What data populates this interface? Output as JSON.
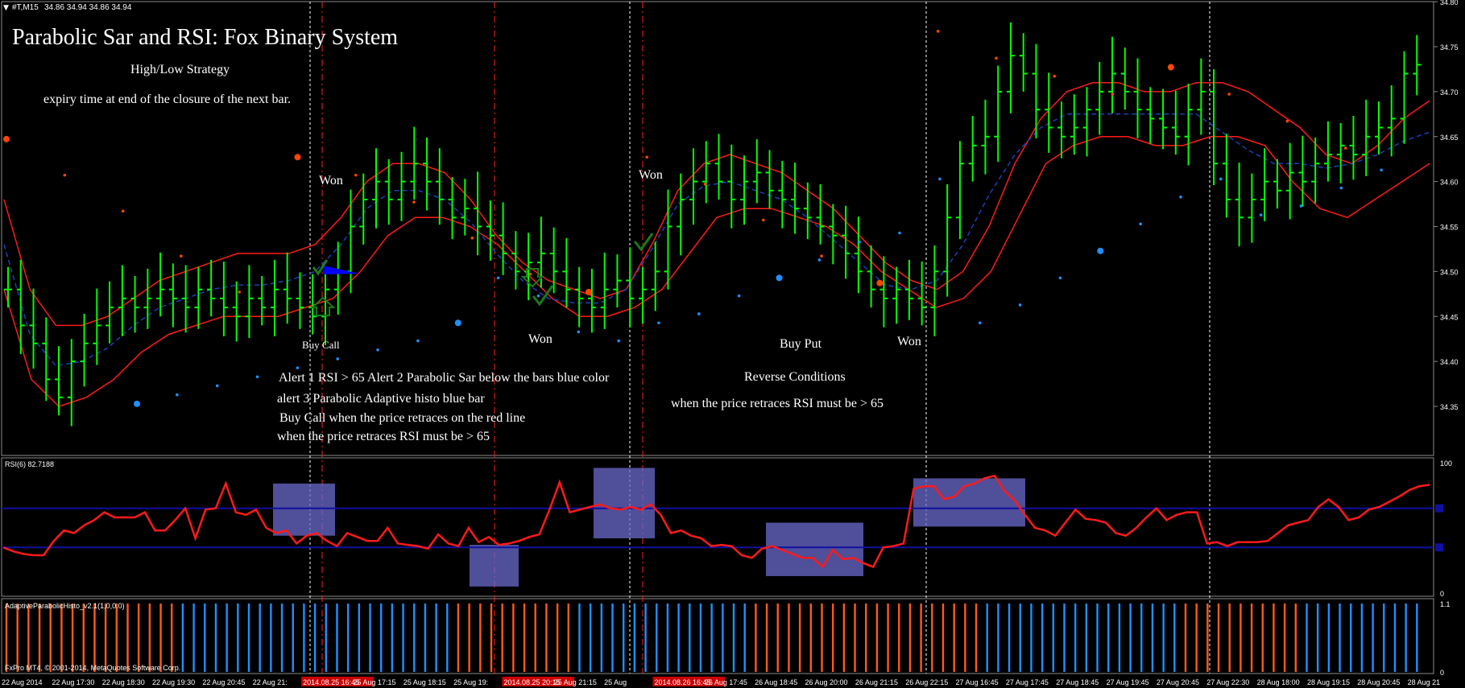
{
  "window": {
    "symbol_header": "#T,M15",
    "ohlc_header": "34.86 34.94 34.86 34.94",
    "copyright": "FxPro MT4, © 2001-2014, MetaQuotes Software Corp."
  },
  "annotations": {
    "title": "Parabolic Sar and RSI: Fox Binary System",
    "subtitle": "High/Low Strategy",
    "expiry": "expiry time at end of the closure of the next bar.",
    "won_1": "Won",
    "won_2": "Won",
    "won_3": "Won",
    "won_4": "Won",
    "buy_call": "Buy Call",
    "buy_put": "Buy Put",
    "alert_line_1": "Alert 1 RSI > 65     Alert 2 Parabolic Sar below the bars blue color",
    "alert_line_2": "alert 3 Parabolic Adaptive histo blue bar",
    "alert_line_3": "Buy Call when the price retraces on the red line",
    "alert_line_4": "when the price retraces RSI must be > 65",
    "reverse_title": "Reverse Conditions",
    "reverse_line": "when the price retraces RSI must be > 65"
  },
  "colors": {
    "background": "#000000",
    "grid": "#7a7a7a",
    "bar_bull": "#00ff00",
    "envelope": "#ff1a1a",
    "midline": "#1c3fb8",
    "sar_up": "#1e90ff",
    "sar_down": "#ff4500",
    "rsi_line": "#ff1a1a",
    "rsi_levels": "#1010a0",
    "box_fill": "#6a6acd",
    "histo_blue": "#1e90ff",
    "histo_orange": "#ff5a1a",
    "event_line": "#ff2020",
    "highlight": "#cc0000"
  },
  "chart_data": [
    {
      "type": "ohlc",
      "title": "#T,M15",
      "ylim": [
        34.3,
        34.8
      ],
      "y_ticks": [
        "34.80",
        "34.75",
        "34.70",
        "34.65",
        "34.60",
        "34.55",
        "34.50",
        "34.45",
        "34.40",
        "34.35"
      ],
      "series": [
        {
          "name": "close",
          "values": [
            34.48,
            34.44,
            34.42,
            34.38,
            34.36,
            34.4,
            34.42,
            34.44,
            34.46,
            34.47,
            34.46,
            34.47,
            34.48,
            34.47,
            34.46,
            34.48,
            34.47,
            34.46,
            34.45,
            34.47,
            34.46,
            34.48,
            34.47,
            34.46,
            34.45,
            34.48,
            34.5,
            34.55,
            34.58,
            34.6,
            34.58,
            34.6,
            34.62,
            34.6,
            34.58,
            34.56,
            34.57,
            34.55,
            34.54,
            34.52,
            34.5,
            34.51,
            34.52,
            34.5,
            34.48,
            34.47,
            34.46,
            34.48,
            34.49,
            34.47,
            34.48,
            34.5,
            34.55,
            34.58,
            34.6,
            34.62,
            34.6,
            34.58,
            34.6,
            34.61,
            34.59,
            34.58,
            34.57,
            34.56,
            34.55,
            34.54,
            34.52,
            34.5,
            34.48,
            34.47,
            34.48,
            34.47,
            34.46,
            34.5,
            34.56,
            34.62,
            34.64,
            34.65,
            34.7,
            34.74,
            34.72,
            34.68,
            34.66,
            34.65,
            34.66,
            34.68,
            34.7,
            34.72,
            34.7,
            34.68,
            34.67,
            34.66,
            34.65,
            34.68,
            34.7,
            34.62,
            34.58,
            34.56,
            34.58,
            34.6,
            34.59,
            34.61,
            34.6,
            34.62,
            34.63,
            34.64,
            34.63,
            34.65,
            34.66,
            34.67,
            34.72,
            34.73
          ]
        },
        {
          "name": "upper_band",
          "values": [
            34.58,
            34.48,
            34.44,
            34.44,
            34.45,
            34.47,
            34.49,
            34.5,
            34.51,
            34.52,
            34.52,
            34.52,
            34.53,
            34.56,
            34.6,
            34.62,
            34.62,
            34.61,
            34.58,
            34.54,
            34.51,
            34.49,
            34.48,
            34.47,
            34.48,
            34.53,
            34.59,
            34.62,
            34.63,
            34.62,
            34.61,
            34.59,
            34.57,
            34.54,
            34.51,
            34.49,
            34.48,
            34.5,
            34.55,
            34.62,
            34.67,
            34.7,
            34.71,
            34.71,
            34.7,
            34.7,
            34.71,
            34.71,
            34.7,
            34.68,
            34.66,
            34.63,
            34.62,
            34.64,
            34.67,
            34.69
          ]
        },
        {
          "name": "lower_band",
          "values": [
            34.48,
            34.38,
            34.35,
            34.36,
            34.38,
            34.41,
            34.43,
            34.44,
            34.45,
            34.45,
            34.45,
            34.46,
            34.47,
            34.5,
            34.54,
            34.56,
            34.56,
            34.55,
            34.53,
            34.5,
            34.47,
            34.45,
            34.45,
            34.46,
            34.48,
            34.52,
            34.56,
            34.57,
            34.57,
            34.56,
            34.55,
            34.53,
            34.5,
            34.48,
            34.46,
            34.47,
            34.5,
            34.56,
            34.62,
            34.64,
            34.65,
            34.65,
            34.64,
            34.64,
            34.65,
            34.65,
            34.64,
            34.6,
            34.57,
            34.56,
            34.58,
            34.6,
            34.62
          ]
        }
      ],
      "sar_up_points": [
        34.36,
        34.37,
        34.38,
        34.39,
        34.4,
        34.41,
        34.42,
        34.43,
        34.45,
        34.5,
        34.48,
        34.44,
        34.43,
        34.45,
        34.46,
        34.48,
        34.5,
        34.52,
        34.54,
        34.55,
        34.61,
        34.45,
        34.47,
        34.5,
        34.53,
        34.56,
        34.59,
        34.61,
        34.57,
        34.58,
        34.6,
        34.62
      ],
      "sar_down_points": [
        34.64,
        34.6,
        34.56,
        34.51,
        34.47,
        34.62,
        34.6,
        34.57,
        34.53,
        34.49,
        34.47,
        34.62,
        34.59,
        34.55,
        34.51,
        34.48,
        34.76,
        34.73,
        34.71,
        34.69,
        34.72,
        34.69,
        34.66,
        34.63
      ]
    },
    {
      "type": "line",
      "title": "RSI(6) 82.7188",
      "ylim": [
        0,
        100
      ],
      "y_ticks": [
        "100",
        "0"
      ],
      "levels": [
        65,
        35
      ],
      "series": [
        {
          "name": "RSI(6)",
          "values": [
            35,
            32,
            30,
            29,
            29,
            40,
            48,
            46,
            52,
            56,
            62,
            58,
            58,
            58,
            62,
            48,
            48,
            56,
            65,
            42,
            64,
            65,
            84,
            62,
            60,
            64,
            50,
            46,
            48,
            38,
            44,
            46,
            40,
            36,
            46,
            43,
            40,
            40,
            50,
            38,
            37,
            36,
            34,
            45,
            38,
            36,
            50,
            39,
            43,
            37,
            38,
            40,
            43,
            45,
            64,
            85,
            62,
            64,
            66,
            68,
            65,
            64,
            66,
            64,
            68,
            60,
            46,
            48,
            44,
            42,
            36,
            37,
            36,
            29,
            27,
            34,
            36,
            33,
            30,
            27,
            27,
            20,
            33,
            26,
            27,
            23,
            20,
            35,
            36,
            38,
            80,
            82,
            82,
            72,
            74,
            82,
            84,
            88,
            90,
            78,
            71,
            60,
            50,
            48,
            44,
            54,
            64,
            57,
            56,
            54,
            46,
            44,
            50,
            58,
            65,
            56,
            60,
            62,
            62,
            38,
            39,
            36,
            39,
            39,
            39,
            40,
            46,
            52,
            54,
            56,
            66,
            72,
            66,
            56,
            58,
            64,
            66,
            70,
            74,
            79,
            82,
            83
          ]
        }
      ],
      "boxes": [
        "RSI > 65",
        "RSI < 35",
        "RSI > 65",
        "RSI < 35",
        "RSI > 65"
      ]
    },
    {
      "type": "bar",
      "title": "AdaptiveParabolicHisto_v2.1(1,0,0.0)",
      "ylim": [
        0,
        1.1
      ],
      "y_ticks": [
        "1.1",
        "0"
      ],
      "series": [
        {
          "name": "down (orange)",
          "values": [
            1,
            1,
            1,
            1,
            1,
            1,
            1,
            1,
            1,
            1,
            1,
            1,
            1,
            1,
            1,
            1,
            0,
            0,
            0,
            0,
            0,
            0,
            0,
            0,
            0,
            0,
            0,
            0,
            0,
            0,
            0,
            0,
            0,
            0,
            0,
            0,
            0,
            0,
            0,
            0,
            0,
            1,
            1,
            1,
            1,
            1,
            1,
            1,
            1,
            1,
            1,
            1,
            0,
            0,
            0,
            0,
            0,
            0,
            0,
            0,
            0,
            0,
            0,
            0,
            0,
            0,
            0,
            0,
            1,
            1,
            1,
            1,
            1,
            1,
            1,
            1,
            1,
            1,
            1,
            1,
            1,
            1,
            1,
            1,
            1,
            1,
            1,
            1,
            1,
            0,
            0,
            0,
            0,
            0,
            0,
            0,
            0,
            0,
            0,
            0,
            0,
            0,
            0,
            0,
            0,
            0,
            0,
            1,
            1,
            1,
            1,
            1,
            1,
            1,
            1,
            1,
            1,
            1,
            0,
            0,
            0,
            0,
            0,
            0,
            0,
            0,
            0,
            0,
            0
          ]
        }
      ]
    }
  ],
  "x_axis": {
    "labels": [
      "22 Aug 2014",
      "22 Aug 17:30",
      "22 Aug 18:30",
      "22 Aug 19:30",
      "22 Aug 20:45",
      "22 Aug 21:",
      "2014.08.25 16:45",
      "25 Aug 17:15",
      "25 Aug 18:15",
      "25 Aug 19:",
      "2014.08.25 20:15",
      "25 Aug 21:15",
      "25 Aug",
      "2014.08.26 16:45",
      "26 Aug 17:45",
      "26 Aug 18:45",
      "26 Aug 20:00",
      "26 Aug 21:15",
      "26 Aug 22:15",
      "27 Aug 16:45",
      "27 Aug 17:45",
      "27 Aug 18:45",
      "27 Aug 19:45",
      "27 Aug 20:45",
      "27 Aug 22:30",
      "28 Aug 18:00",
      "28 Aug 19:15",
      "28 Aug 20:45",
      "28 Aug 21"
    ],
    "highlighted": [
      "2014.08.25 16:45",
      "2014.08.25 20:15",
      "2014.08.26 16:45"
    ]
  }
}
